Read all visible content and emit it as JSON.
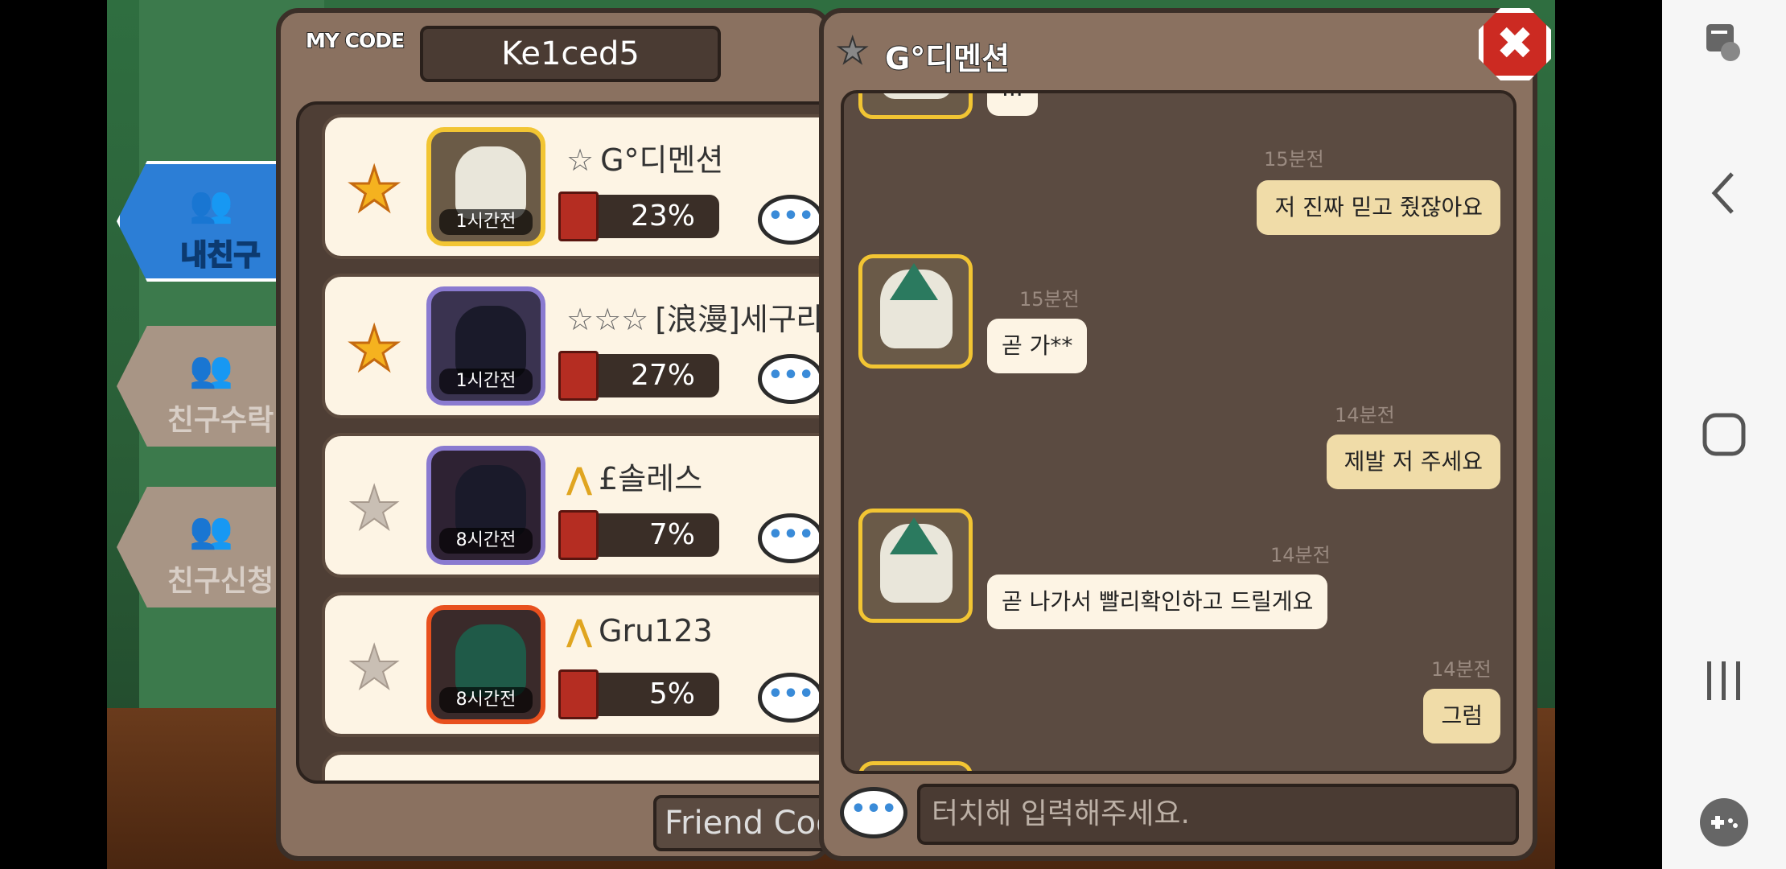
{
  "my_code": {
    "label": "MY CODE",
    "value": "Ke1ced5"
  },
  "tabs": [
    {
      "label": "내친구",
      "active": true
    },
    {
      "label": "친구수락",
      "active": false
    },
    {
      "label": "친구신청",
      "active": false
    }
  ],
  "friends": [
    {
      "favorite": true,
      "name": "G°디멘션",
      "rank_icon": "star",
      "rank_count": 1,
      "last_seen": "1시간전",
      "progress": "23%",
      "avatar_frame": "#f2c533",
      "avatar_bg": "#6b5b47"
    },
    {
      "favorite": true,
      "name": "[浪漫]세구라",
      "rank_icon": "star",
      "rank_count": 3,
      "last_seen": "1시간전",
      "progress": "27%",
      "avatar_frame": "#8a7ad0",
      "avatar_bg": "#3a3350"
    },
    {
      "favorite": false,
      "name": "£솔레스",
      "rank_icon": "chevron",
      "rank_count": 1,
      "last_seen": "8시간전",
      "progress": "7%",
      "avatar_frame": "#8a7ad0",
      "avatar_bg": "#2e2233"
    },
    {
      "favorite": false,
      "name": "Gru123",
      "rank_icon": "chevron",
      "rank_count": 1,
      "last_seen": "8시간전",
      "progress": "5%",
      "avatar_frame": "#e8501e",
      "avatar_bg": "#3a2a2a"
    }
  ],
  "friend_code_button": "Friend Code",
  "chat": {
    "title": "G°디멘션",
    "partial_top_text": "...",
    "messages": [
      {
        "side": "right",
        "time": "15분전",
        "text": "저 진짜 믿고 줬잖아요"
      },
      {
        "side": "left",
        "time": "15분전",
        "text": "곧 가**"
      },
      {
        "side": "right",
        "time": "14분전",
        "text": "제발 저 주세요"
      },
      {
        "side": "left",
        "time": "14분전",
        "text": "곧 나가서 빨리확인하고 드릴게요"
      },
      {
        "side": "right",
        "time": "14분전",
        "text": "그럼"
      }
    ],
    "input_placeholder": "터치해 입력해주세요.",
    "close_label": "✖"
  },
  "icons": {
    "star": "★",
    "chat": "•••",
    "nav_screenshot": "screenshot-icon",
    "nav_back": "back-icon",
    "nav_home": "home-icon",
    "nav_recents": "recents-icon",
    "nav_game": "game-tools-icon"
  },
  "colors": {
    "star_gold": "#f5b21f",
    "star_gray": "#c9bfb4",
    "tab_active": "#2c7ed6",
    "tab_inactive": "#a89585"
  }
}
